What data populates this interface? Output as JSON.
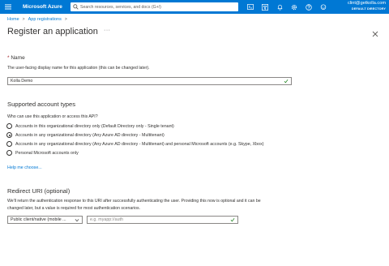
{
  "topbar": {
    "brand": "Microsoft Azure",
    "search_placeholder": "Search resources, services, and docs (G+/)",
    "icons": [
      "terminal-icon",
      "directory-filter-icon",
      "bell-icon",
      "gear-icon",
      "help-icon",
      "feedback-icon"
    ],
    "account_email": "clint@getkolla.com",
    "account_directory": "DEFAULT DIRECTORY",
    "accent_color": "#0078d4"
  },
  "breadcrumb": {
    "items": [
      "Home",
      "App registrations"
    ]
  },
  "page": {
    "title": "Register an application",
    "more": "···"
  },
  "name_section": {
    "label": "Name",
    "required_mark": "* ",
    "help": "The user-facing display name for this application (this can be changed later).",
    "value": "Kolla Demo"
  },
  "accounts_section": {
    "title": "Supported account types",
    "question": "Who can use this application or access this API?",
    "options": [
      {
        "label": "Accounts in this organizational directory only (Default Directory only - Single tenant)",
        "selected": false
      },
      {
        "label": "Accounts in any organizational directory (Any Azure AD directory - Multitenant)",
        "selected": true
      },
      {
        "label": "Accounts in any organizational directory (Any Azure AD directory - Multitenant) and personal Microsoft accounts (e.g. Skype, Xbox)",
        "selected": false
      },
      {
        "label": "Personal Microsoft accounts only",
        "selected": false
      }
    ],
    "help_link": "Help me choose..."
  },
  "redirect_section": {
    "title": "Redirect URI (optional)",
    "help_line1": "We'll return the authentication response to this URI after successfully authenticating the user. Providing this now is optional and it can be",
    "help_line2": "changed later, but a value is required for most authentication scenarios.",
    "platform_value": "Public client/native (mobile ...",
    "uri_placeholder": "e.g. myapp://auth"
  }
}
